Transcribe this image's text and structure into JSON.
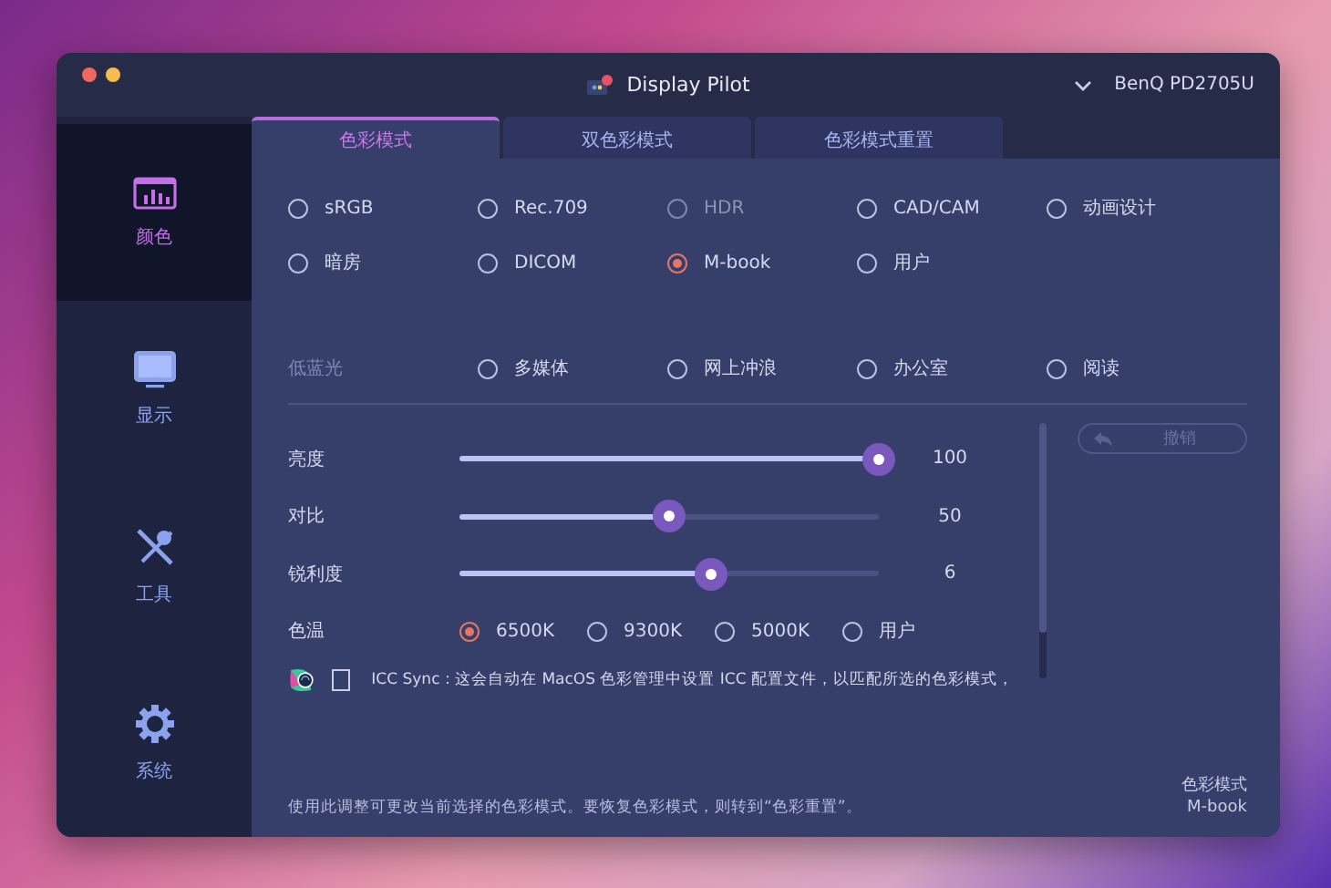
{
  "window": {
    "title": "Display Pilot",
    "device": "BenQ PD2705U"
  },
  "sidebar": {
    "items": [
      {
        "label": "颜色",
        "selected": true
      },
      {
        "label": "显示",
        "selected": false
      },
      {
        "label": "工具",
        "selected": false
      },
      {
        "label": "系统",
        "selected": false
      }
    ]
  },
  "tabs": [
    {
      "label": "色彩模式",
      "selected": true
    },
    {
      "label": "双色彩模式",
      "selected": false
    },
    {
      "label": "色彩模式重置",
      "selected": false
    }
  ],
  "color_modes": [
    {
      "label": "sRGB",
      "selected": false,
      "disabled": false
    },
    {
      "label": "Rec.709",
      "selected": false,
      "disabled": false
    },
    {
      "label": "HDR",
      "selected": false,
      "disabled": true
    },
    {
      "label": "CAD/CAM",
      "selected": false,
      "disabled": false
    },
    {
      "label": "动画设计",
      "selected": false,
      "disabled": false
    },
    {
      "label": "暗房",
      "selected": false,
      "disabled": false
    },
    {
      "label": "DICOM",
      "selected": false,
      "disabled": false
    },
    {
      "label": "M-book",
      "selected": true,
      "disabled": false
    },
    {
      "label": "用户",
      "selected": false,
      "disabled": false
    }
  ],
  "low_blue_light": {
    "label": "低蓝光",
    "options": [
      {
        "label": "多媒体",
        "selected": false
      },
      {
        "label": "网上冲浪",
        "selected": false
      },
      {
        "label": "办公室",
        "selected": false
      },
      {
        "label": "阅读",
        "selected": false
      }
    ]
  },
  "sliders": [
    {
      "label": "亮度",
      "level": 1.0,
      "reading": "100"
    },
    {
      "label": "对比",
      "level": 0.5,
      "reading": "50"
    },
    {
      "label": "锐利度",
      "level": 0.6,
      "reading": "6"
    }
  ],
  "color_temp": {
    "label": "色温",
    "options": [
      {
        "label": "6500K",
        "selected": true
      },
      {
        "label": "9300K",
        "selected": false
      },
      {
        "label": "5000K",
        "selected": false
      },
      {
        "label": "用户",
        "selected": false
      }
    ]
  },
  "icc_sync": {
    "checked": false,
    "text": "ICC Sync : 这会自动在 MacOS 色彩管理中设置 ICC 配置文件，以匹配所选的色彩模式，"
  },
  "undo_button": {
    "label": "撤销",
    "disabled": true
  },
  "footer": {
    "note": "使用此调整可更改当前选择的色彩模式。要恢复色彩模式，则转到“色彩重置”。",
    "mode_label": "色彩模式",
    "mode_value": "M-book"
  }
}
